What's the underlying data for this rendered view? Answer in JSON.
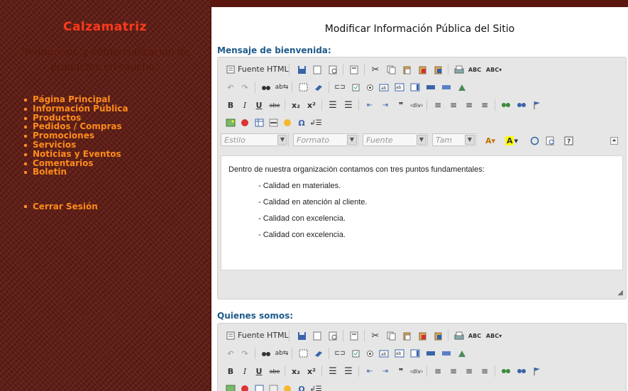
{
  "sidebar": {
    "brand": "Calzamatriz",
    "slogan": "\"Producción y comercialización de productos en caucho\"",
    "menu": [
      "Página Principal",
      "Información Pública",
      "Productos",
      "Pedidos / Compras",
      "Promociones",
      "Servicios",
      "Noticias y Eventos",
      "Comentarios",
      "Boletin"
    ],
    "logout": "Cerrar Sesión"
  },
  "main": {
    "title": "Modificar Información Pública del Sitio",
    "section1_label": "Mensaje de bienvenida:",
    "section2_label": "Quienes somos:",
    "editor1": {
      "intro": "Dentro de nuestra organización contamos con tres puntos fundamentales:",
      "bullets": [
        "- Calidad en materiales.",
        "- Calidad en atención al cliente.",
        "- Calidad con excelencia.",
        "- Calidad con excelencia."
      ]
    }
  },
  "toolbar": {
    "source_label": "Fuente HTML",
    "style_combo": "Estilo",
    "format_combo": "Formato",
    "font_combo": "Fuente",
    "size_combo": "Tam"
  },
  "colors": {
    "accent_link": "#ff8c1a",
    "brand": "#ff3a1a",
    "section_label": "#1e5a8a"
  }
}
